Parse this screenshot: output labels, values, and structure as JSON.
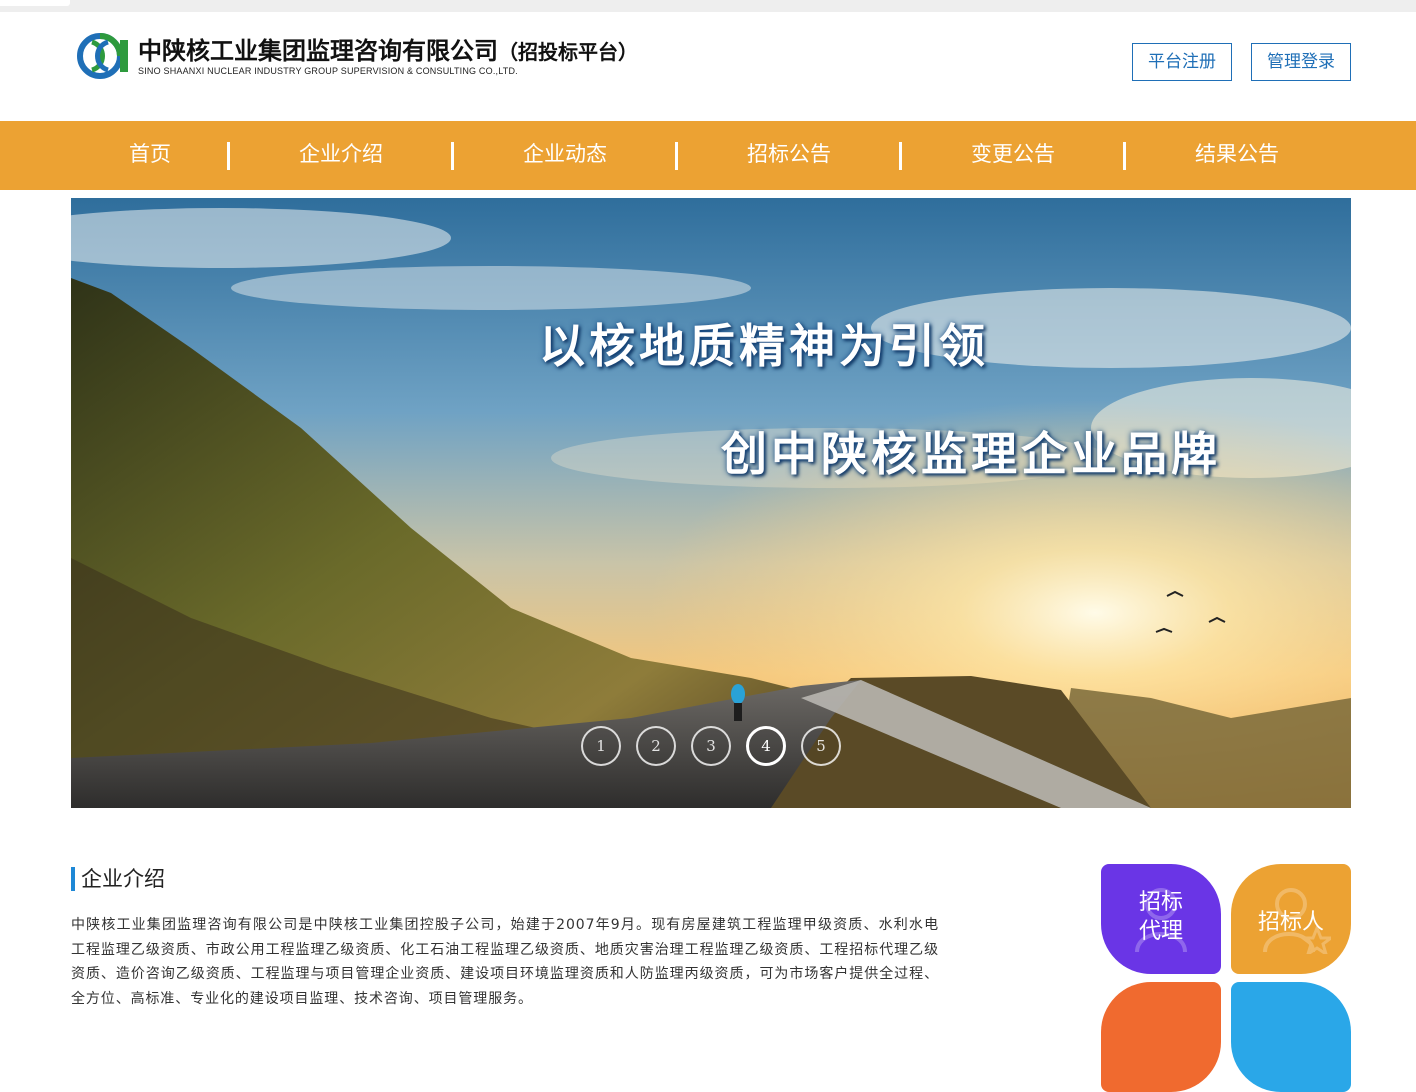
{
  "header": {
    "company_name": "中陕核工业集团监理咨询有限公司",
    "platform_suffix": "（招投标平台）",
    "company_name_en": "SINO SHAANXI NUCLEAR INDUSTRY GROUP SUPERVISION & CONSULTING CO.,LTD.",
    "register_label": "平台注册",
    "login_label": "管理登录"
  },
  "nav": {
    "items": [
      {
        "label": "首页"
      },
      {
        "label": "企业介绍"
      },
      {
        "label": "企业动态"
      },
      {
        "label": "招标公告"
      },
      {
        "label": "变更公告"
      },
      {
        "label": "结果公告"
      }
    ]
  },
  "banner": {
    "slogan_line1": "以核地质精神为引领",
    "slogan_line2": "创中陕核监理企业品牌",
    "dots": [
      "1",
      "2",
      "3",
      "4",
      "5"
    ],
    "active_dot": 4
  },
  "intro": {
    "title": "企业介绍",
    "text": "中陕核工业集团监理咨询有限公司是中陕核工业集团控股子公司，始建于2007年9月。现有房屋建筑工程监理甲级资质、水利水电工程监理乙级资质、市政公用工程监理乙级资质、化工石油工程监理乙级资质、地质灾害治理工程监理乙级资质、工程招标代理乙级资质、造价咨询乙级资质、工程监理与项目管理企业资质、建设项目环境监理资质和人防监理丙级资质，可为市场客户提供全过程、全方位、高标准、专业化的建设项目监理、技术咨询、项目管理服务。"
  },
  "tiles": {
    "agent_label_1": "招标",
    "agent_label_2": "代理",
    "tenderer_label": "招标人"
  },
  "colors": {
    "nav_bg": "#eca233",
    "accent_blue": "#1f6fb7",
    "tile_purple": "#6a35e6",
    "tile_orange": "#eca233",
    "tile_red": "#f06a2f",
    "tile_blue": "#2aa7e8"
  }
}
